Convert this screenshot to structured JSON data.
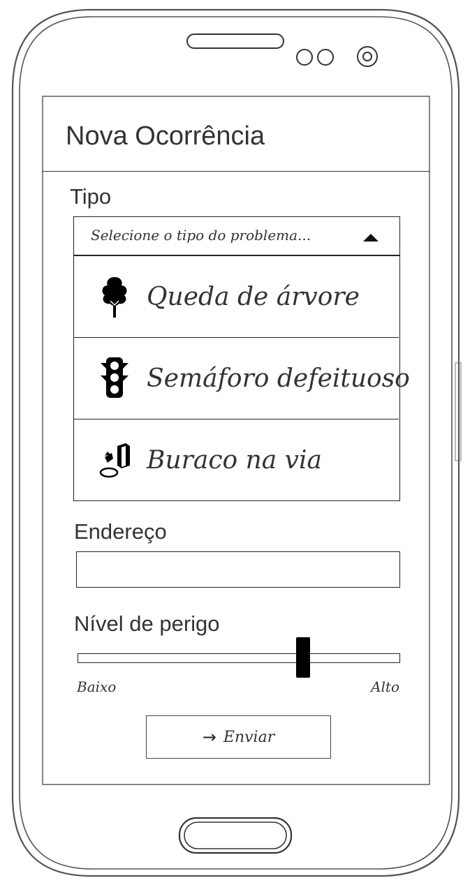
{
  "app": {
    "title": "Nova Ocorrência"
  },
  "form": {
    "type_label": "Tipo",
    "type_select": {
      "placeholder": "Selecione o tipo do problema...",
      "expanded": true,
      "options": [
        {
          "label": "Queda de árvore",
          "icon": "tree-icon"
        },
        {
          "label": "Semáforo defeituoso",
          "icon": "traffic-light-icon"
        },
        {
          "label": "Buraco na via",
          "icon": "pothole-icon"
        }
      ]
    },
    "address_label": "Endereço",
    "address_value": "",
    "danger_label": "Nível de perigo",
    "danger_slider": {
      "min_label": "Baixo",
      "max_label": "Alto",
      "level": 0.7
    },
    "submit": {
      "label": "Enviar",
      "icon": "arrow-right-icon"
    }
  }
}
